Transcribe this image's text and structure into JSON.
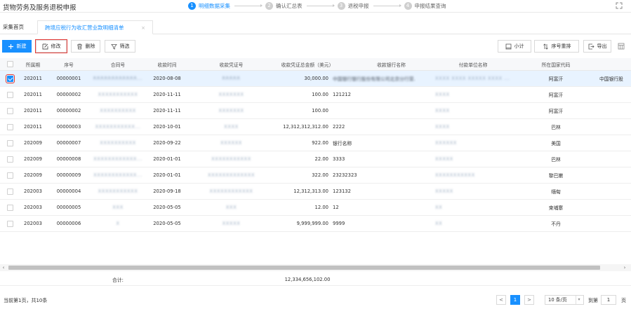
{
  "app": {
    "title": "货物劳务及服务退税申报"
  },
  "steps": [
    {
      "num": "1",
      "label": "明细数据采集",
      "active": true
    },
    {
      "num": "2",
      "label": "确认汇总表",
      "active": false
    },
    {
      "num": "3",
      "label": "退税申报",
      "active": false
    },
    {
      "num": "4",
      "label": "申报结果查询",
      "active": false
    }
  ],
  "tabs": {
    "home": "采集首页",
    "active": "跨境应税行为收汇营业款明细清单",
    "close": "×"
  },
  "toolbar": {
    "new": "新建",
    "edit": "修改",
    "delete": "删除",
    "filter": "筛选",
    "subtotal": "小计",
    "reorder": "序号重排",
    "export": "导出"
  },
  "columns": [
    "所属期",
    "序号",
    "合同号",
    "收款时间",
    "收款凭证号",
    "收款凭证总金额（美元）",
    "收款银行名称",
    "付款单位名称",
    "所在国家代码"
  ],
  "rows": [
    {
      "period": "202011",
      "seq": "00000001",
      "contract": "RRRRRRRRRRRR...",
      "date": "2020-08-08",
      "voucher": "RRRRR",
      "amount": "30,000.00",
      "bank": "中国银行银行股份有限公司北京分行营...",
      "payer": "ХХХХ ХХХХ ХХХХХ ХХХХ ...",
      "country": "阿富汗",
      "extra": "中国银行股"
    },
    {
      "period": "202011",
      "seq": "00000002",
      "contract": "XXXXXXXXXXX",
      "date": "2020-11-11",
      "voucher": "XXXXXXX",
      "amount": "100.00",
      "bank": "121212",
      "payer": "XXXX",
      "country": "阿富汗",
      "extra": ""
    },
    {
      "period": "202011",
      "seq": "00000002",
      "contract": "XXXXXXXXXX",
      "date": "2020-11-11",
      "voucher": "XXXXXXX",
      "amount": "100.00",
      "bank": "",
      "payer": "XXXX",
      "country": "阿富汗",
      "extra": ""
    },
    {
      "period": "202011",
      "seq": "00000003",
      "contract": "XXXXXXXXXXX...",
      "date": "2020-10-01",
      "voucher": "XXXX",
      "amount": "12,312,312,312.00",
      "bank": "2222",
      "payer": "XXXX",
      "country": "巴林",
      "extra": ""
    },
    {
      "period": "202009",
      "seq": "00000007",
      "contract": "XXXXXXXXXX",
      "date": "2020-09-22",
      "voucher": "XXXXXX",
      "amount": "922.00",
      "bank": "银行名称",
      "payer": "XXXXXX",
      "country": "美国",
      "extra": ""
    },
    {
      "period": "202009",
      "seq": "00000008",
      "contract": "XXXXXXXXXXXX...",
      "date": "2020-01-01",
      "voucher": "XXXXXXXXXXX",
      "amount": "22.00",
      "bank": "3333",
      "payer": "XXXXX",
      "country": "巴林",
      "extra": ""
    },
    {
      "period": "202009",
      "seq": "00000009",
      "contract": "XXXXXXXXXXXX...",
      "date": "2020-01-01",
      "voucher": "XXXXXXXXXXXXX",
      "amount": "322.00",
      "bank": "23232323",
      "payer": "XXXXXXXXXXX",
      "country": "黎巴嫩",
      "extra": ""
    },
    {
      "period": "202003",
      "seq": "00000004",
      "contract": "XXXXXXXXXXX",
      "date": "2020-09-18",
      "voucher": "XXXXXXXXXXXX",
      "amount": "12,312,313.00",
      "bank": "123132",
      "payer": "XXXXX",
      "country": "缅甸",
      "extra": ""
    },
    {
      "period": "202003",
      "seq": "00000005",
      "contract": "XXX",
      "date": "2020-05-05",
      "voucher": "XXX",
      "amount": "12.00",
      "bank": "12",
      "payer": "XX",
      "country": "柬埔寨",
      "extra": ""
    },
    {
      "period": "202003",
      "seq": "00000006",
      "contract": "X",
      "date": "2020-05-05",
      "voucher": "XXXXX",
      "amount": "9,999,999.00",
      "bank": "9999",
      "payer": "XX",
      "country": "不丹",
      "extra": ""
    }
  ],
  "total": {
    "label": "合计:",
    "amount": "12,334,656,102.00"
  },
  "pagination": {
    "info": "当前第1页，共10条",
    "prev": "<",
    "current": "1",
    "next": ">",
    "page_size": "10 条/页",
    "goto_label": "到第",
    "goto_value": "1",
    "goto_suffix": "页"
  },
  "colors": {
    "accent": "#1890ff",
    "highlight": "#e53935",
    "selected_row": "#e8f3ff"
  }
}
